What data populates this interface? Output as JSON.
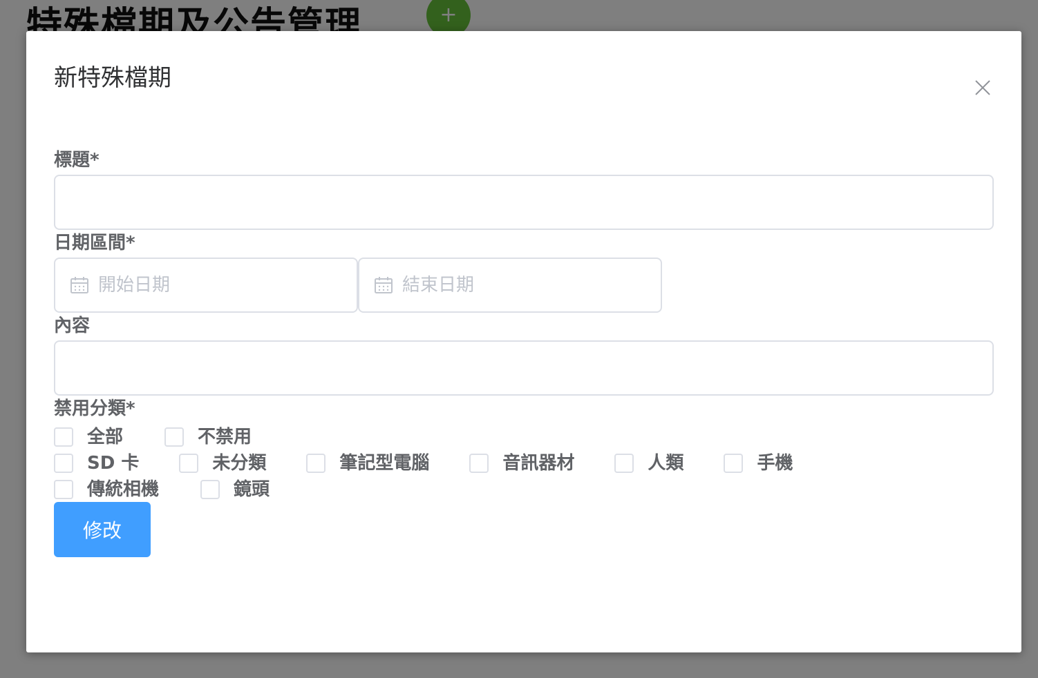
{
  "background": {
    "page_title": "特殊檔期及公告管理",
    "add_button_label": "+"
  },
  "dialog": {
    "title": "新特殊檔期",
    "close_icon": "close-icon"
  },
  "form": {
    "title_label": "標題*",
    "title_value": "",
    "date_range_label": "日期區間*",
    "start_date_placeholder": "開始日期",
    "end_date_placeholder": "結束日期",
    "date_icon": "calendar-icon",
    "content_label": "內容",
    "content_value": "",
    "category_label": "禁用分類*",
    "categories_row1": [
      "全部",
      "不禁用"
    ],
    "categories_row2": [
      "SD 卡",
      "未分類",
      "筆記型電腦",
      "音訊器材",
      "人類",
      "手機"
    ],
    "categories_row3": [
      "傳統相機",
      "鏡頭"
    ],
    "submit_label": "修改"
  },
  "colors": {
    "primary": "#409eff",
    "border": "#dcdfe6",
    "label": "#606266",
    "placeholder": "#c0c4cc",
    "add_button": "#67c23a"
  }
}
